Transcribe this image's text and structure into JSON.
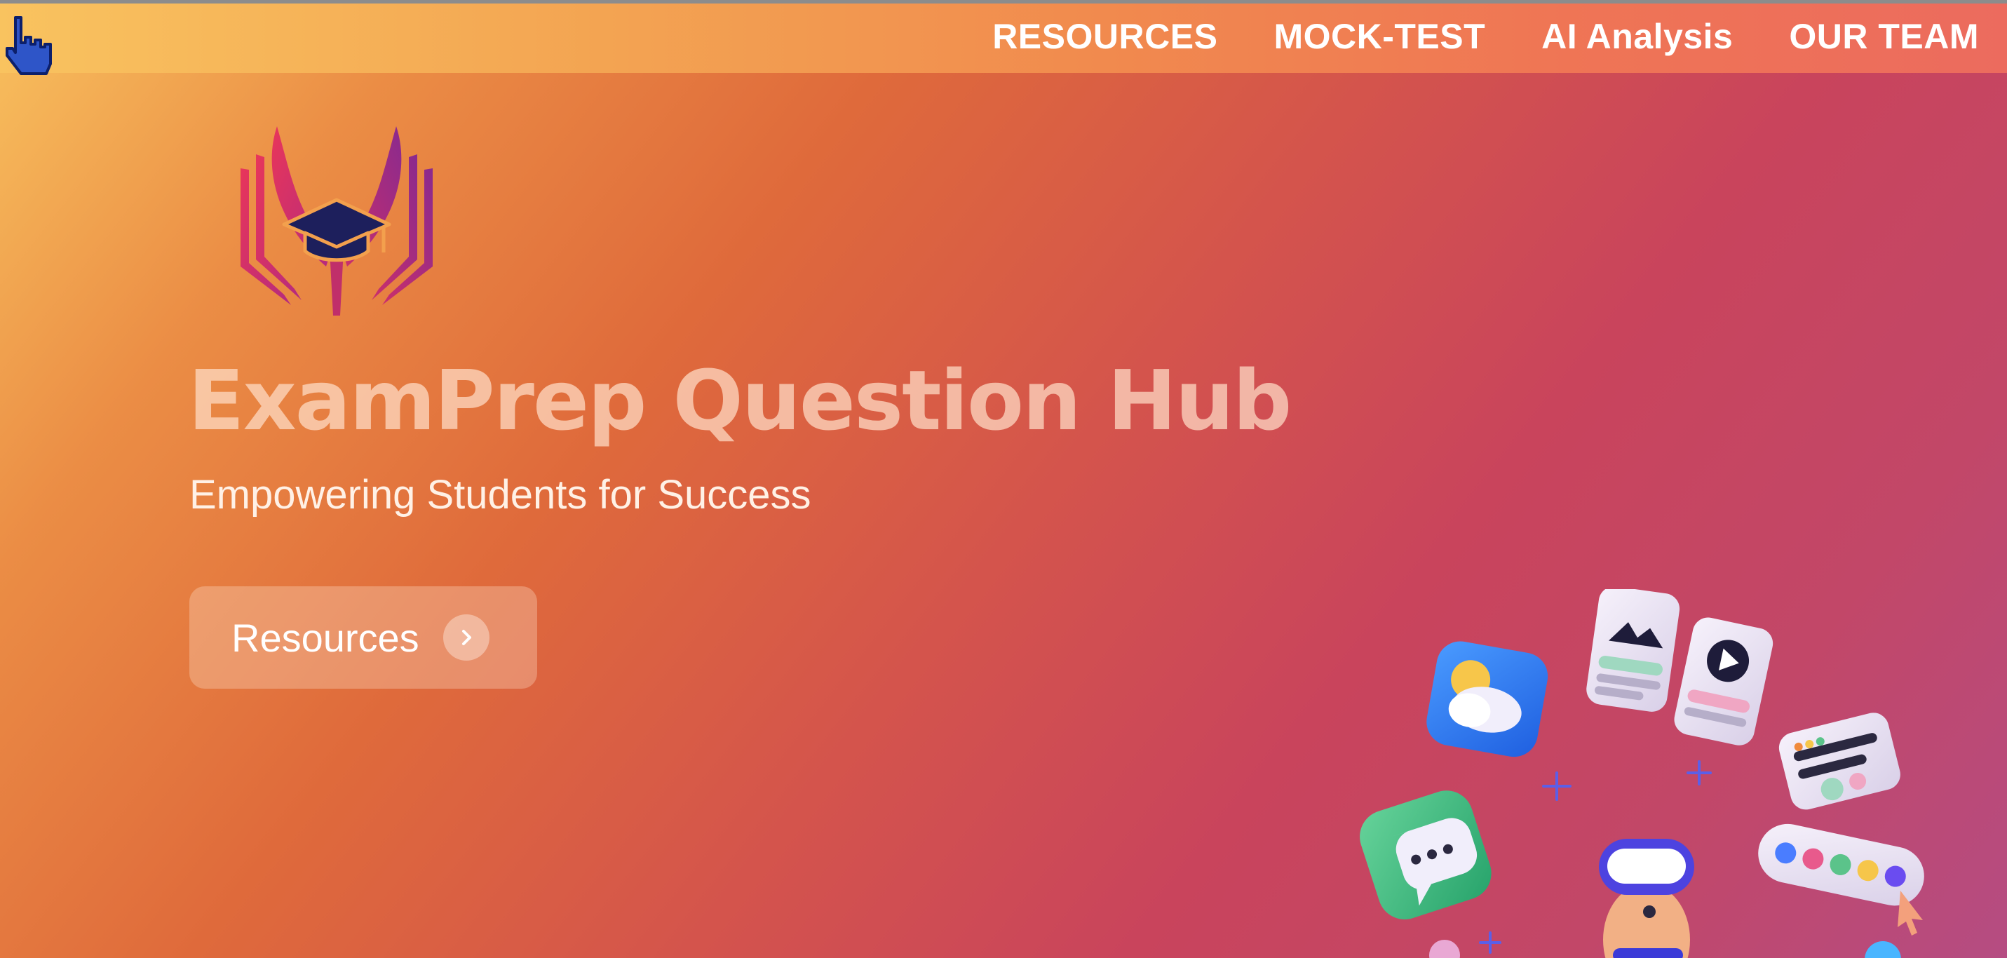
{
  "nav": {
    "items": [
      {
        "label": "RESOURCES"
      },
      {
        "label": "MOCK-TEST"
      },
      {
        "label": "AI Analysis"
      },
      {
        "label": "OUR TEAM"
      }
    ]
  },
  "hero": {
    "title": "ExamPrep Question Hub",
    "subtitle": "Empowering Students for Success",
    "cta_label": "Resources"
  },
  "icons": {
    "logo": "book-graduation-cap-logo",
    "cta": "chevron-right-icon",
    "cursor": "pointer-hand-cursor"
  },
  "colors": {
    "nav_text": "#ffffff",
    "logo_crimson": "#d42f5c",
    "logo_purple": "#9b2a86",
    "cap_navy": "#1d1f5c"
  }
}
